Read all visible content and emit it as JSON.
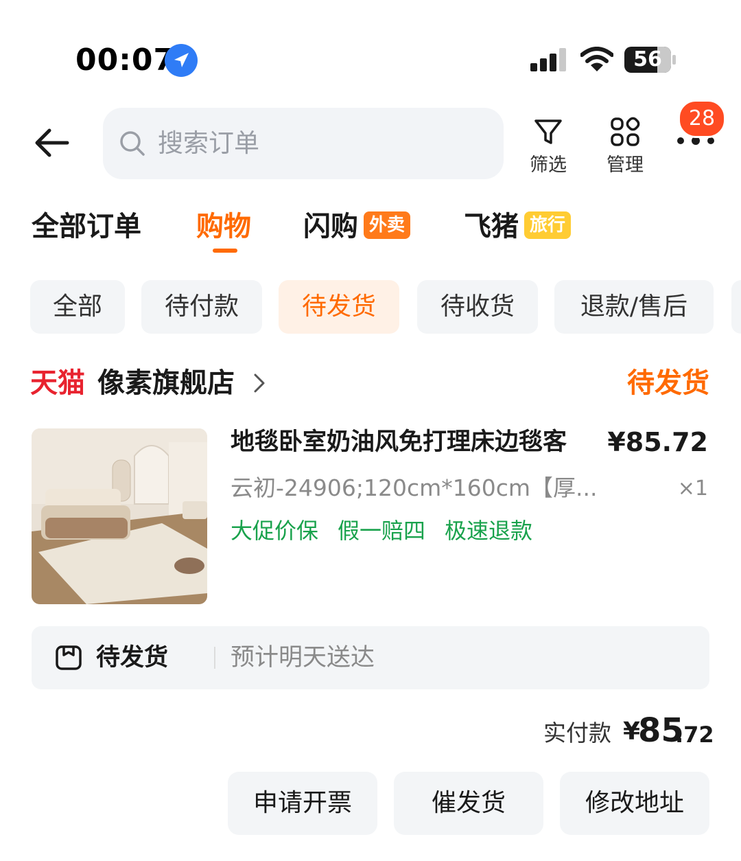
{
  "status_bar": {
    "time": "00:07",
    "battery": "56"
  },
  "header": {
    "search_placeholder": "搜索订单",
    "filter_label": "筛选",
    "manage_label": "管理",
    "more_badge": "28"
  },
  "main_tabs": [
    {
      "label": "全部订单",
      "tag": ""
    },
    {
      "label": "购物",
      "tag": ""
    },
    {
      "label": "闪购",
      "tag": "外卖"
    },
    {
      "label": "飞猪",
      "tag": "旅行"
    }
  ],
  "active_main_tab": "购物",
  "sub_tabs": [
    "全部",
    "待付款",
    "待发货",
    "待收货",
    "退款/售后"
  ],
  "active_sub_tab": "待发货",
  "order": {
    "platform": "天猫",
    "shop": "像素旗舰店",
    "status": "待发货",
    "product": {
      "title": "地毯卧室奶油风免打理床边毯客",
      "price": "¥85.72",
      "sku": "云初-24906;120cm*160cm【厚...",
      "quantity": "×1",
      "services": [
        "大促价保",
        "假一赔四",
        "极速退款"
      ]
    },
    "shipping": {
      "status": "待发货",
      "eta": "预计明天送达"
    },
    "paid": {
      "label": "实付款",
      "currency": "¥",
      "integer": "85",
      "decimal": ".72"
    },
    "actions": [
      "申请开票",
      "催发货",
      "修改地址"
    ]
  },
  "colors": {
    "accent": "#ff6a00",
    "tmall_red": "#e8232f",
    "service_green": "#19a24c",
    "badge_red": "#ff4b22"
  }
}
